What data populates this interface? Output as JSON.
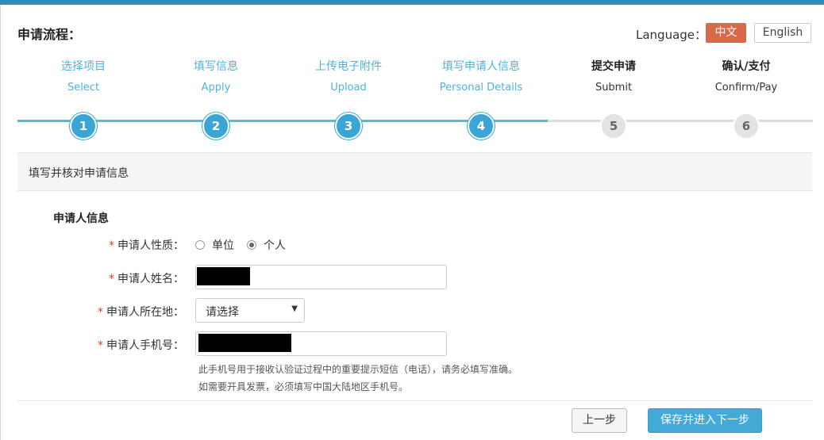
{
  "header": {
    "title": "申请流程：",
    "language_label": "Language：",
    "lang_zh": "中文",
    "lang_en": "English"
  },
  "steps": [
    {
      "cn": "选择项目",
      "en": "Select",
      "num": "1",
      "status": "done"
    },
    {
      "cn": "填写信息",
      "en": "Apply",
      "num": "2",
      "status": "done"
    },
    {
      "cn": "上传电子附件",
      "en": "Upload",
      "num": "3",
      "status": "done"
    },
    {
      "cn": "填写申请人信息",
      "en": "Personal Details",
      "num": "4",
      "status": "done"
    },
    {
      "cn": "提交申请",
      "en": "Submit",
      "num": "5",
      "status": "todo"
    },
    {
      "cn": "确认/支付",
      "en": "Confirm/Pay",
      "num": "6",
      "status": "todo"
    }
  ],
  "section": {
    "title": "填写并核对申请信息",
    "subtitle": "申请人信息"
  },
  "form": {
    "required_mark": "*",
    "nature_label": "申请人性质：",
    "nature_options": [
      "单位",
      "个人"
    ],
    "nature_selected": "个人",
    "name_label": "申请人姓名：",
    "location_label": "申请人所在地：",
    "location_value": "请选择",
    "phone_label": "申请人手机号：",
    "phone_hint": "此手机号用于接收认验证过程中的重要提示短信（电话），请务必填写准确。如需要开具发票，必须填写中国大陆地区手机号。"
  },
  "buttons": {
    "prev": "上一步",
    "next": "保存并进入下一步"
  },
  "colors": {
    "accent": "#43a9d6",
    "lang_active": "#d9694b",
    "required": "#e03a2c"
  }
}
